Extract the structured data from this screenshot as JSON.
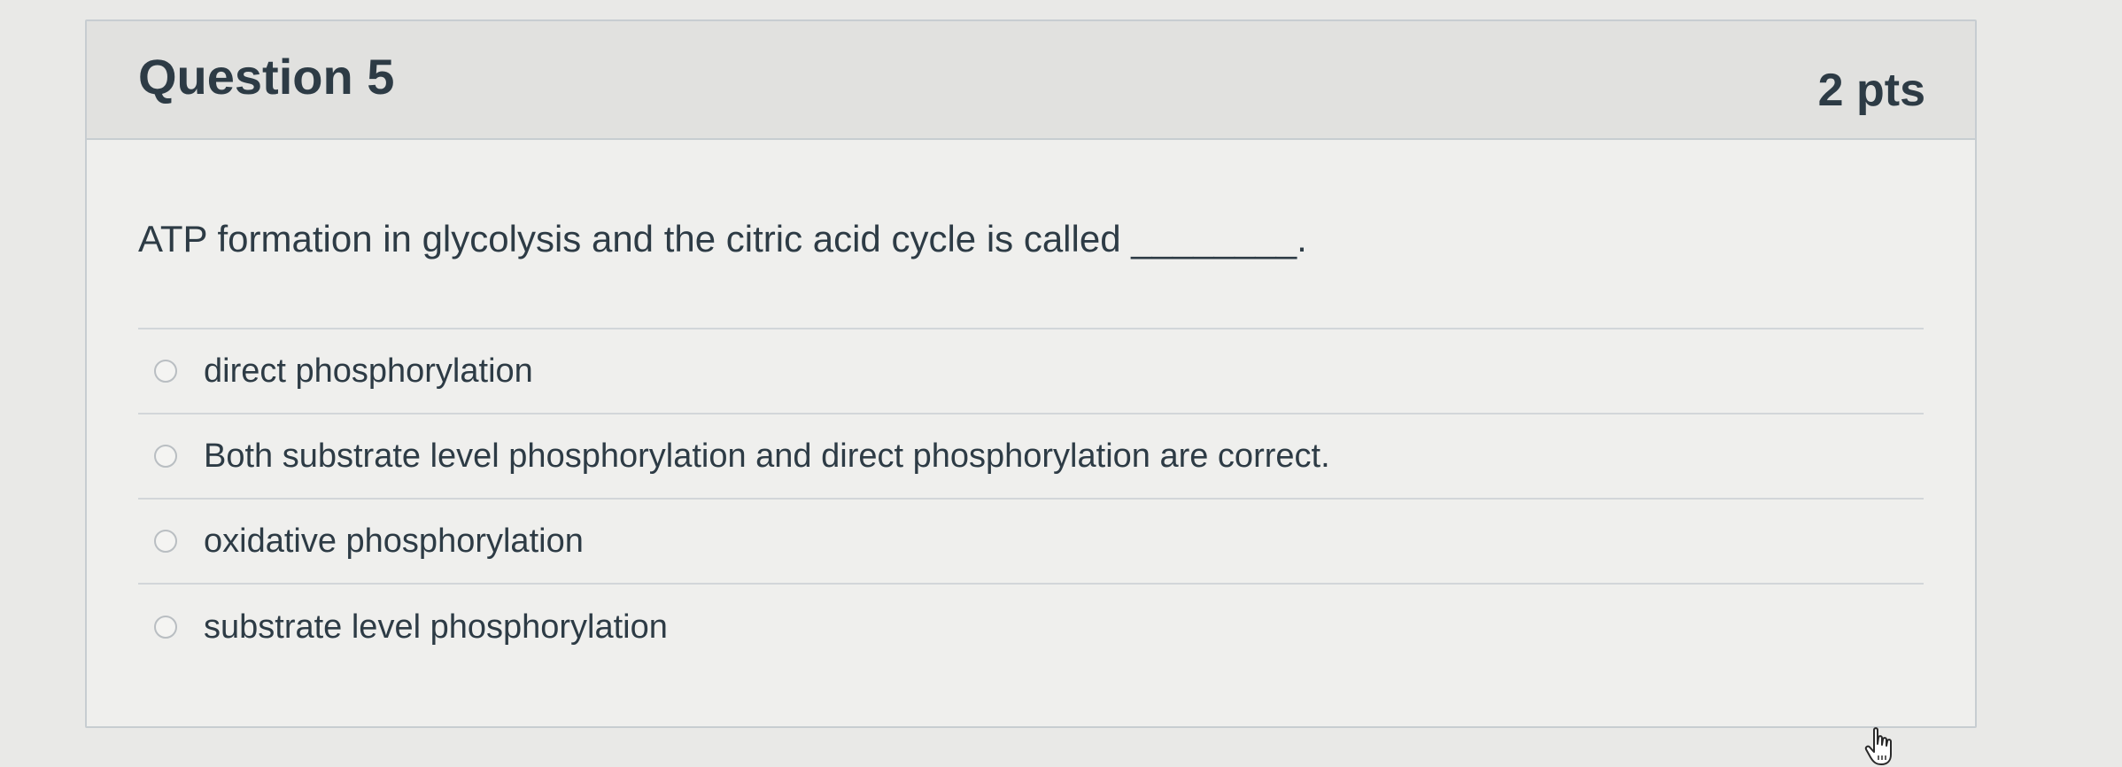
{
  "question": {
    "title": "Question 5",
    "points": "2 pts",
    "text": "ATP formation in glycolysis and the citric acid cycle is called ________."
  },
  "answers": [
    {
      "label": "direct phosphorylation"
    },
    {
      "label": "Both substrate level phosphorylation and direct phosphorylation are correct."
    },
    {
      "label": "oxidative phosphorylation"
    },
    {
      "label": "substrate level phosphorylation"
    }
  ],
  "icons": {
    "radio": "radio-button-unselected-icon",
    "cursor": "hand-pointer-icon"
  },
  "colors": {
    "text": "#2d3b45",
    "header_bg": "#e1e1df",
    "border": "#c7cdd1"
  }
}
